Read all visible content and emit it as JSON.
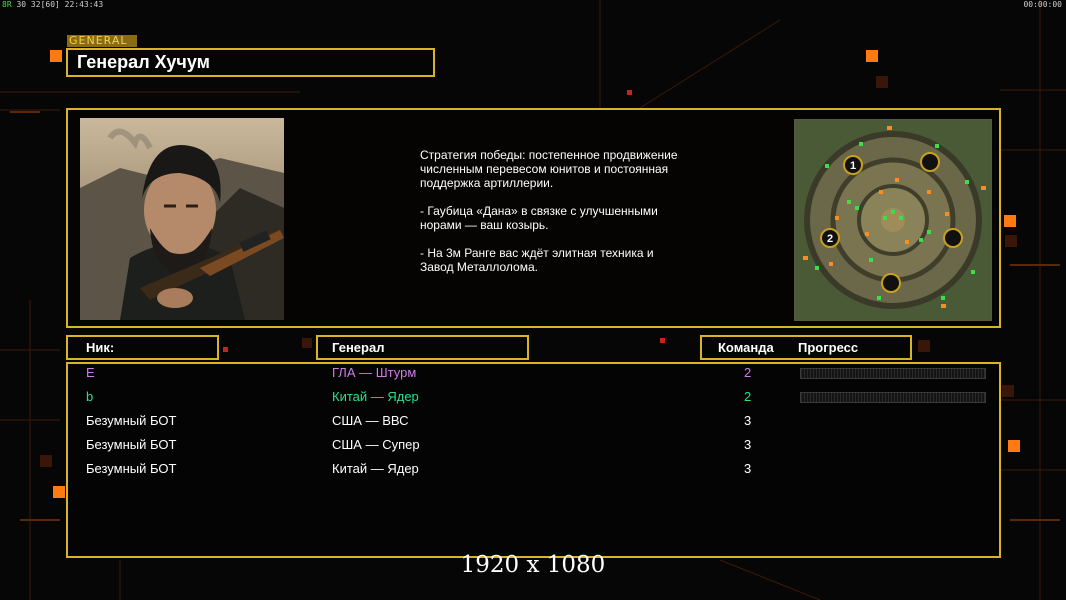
{
  "hud": {
    "left_prefix": "8R",
    "left_values": "30 32",
    "left_bracket": "[60]",
    "clock": "22:43:43",
    "right_timer": "00:00:00"
  },
  "general": {
    "tag": "GENERAL",
    "name": "Генерал Хучум",
    "strategy": [
      "Стратегия победы: постепенное продвижение численным перевесом юнитов и постоянная поддержка артиллерии.",
      "- Гаубица «Дана» в связке с улучшенными норами — ваш козырь.",
      "- На 3м Ранге вас ждёт элитная техника и Завод Металлолома."
    ]
  },
  "minimap": {
    "start_markers": [
      "1",
      "2"
    ]
  },
  "table": {
    "headers": {
      "nick": "Ник:",
      "general": "Генерал",
      "team": "Команда",
      "progress": "Прогресс"
    },
    "rows": [
      {
        "nick": "E",
        "general": "ГЛА — Штурм",
        "team": "2",
        "color": "#d07be8",
        "has_progress": true
      },
      {
        "nick": "b",
        "general": "Китай — Ядер",
        "team": "2",
        "color": "#28e08a",
        "has_progress": true
      },
      {
        "nick": "Безумный БОТ",
        "general": "США — ВВС",
        "team": "3",
        "color": "#ffffff",
        "has_progress": false
      },
      {
        "nick": "Безумный БОТ",
        "general": "США — Супер",
        "team": "3",
        "color": "#ffffff",
        "has_progress": false
      },
      {
        "nick": "Безумный БОТ",
        "general": "Китай — Ядер",
        "team": "3",
        "color": "#ffffff",
        "has_progress": false
      }
    ]
  },
  "resolution_label": "1920 x 1080",
  "colors": {
    "frame": "#d9b526",
    "accent_orange": "#ff7a10"
  }
}
